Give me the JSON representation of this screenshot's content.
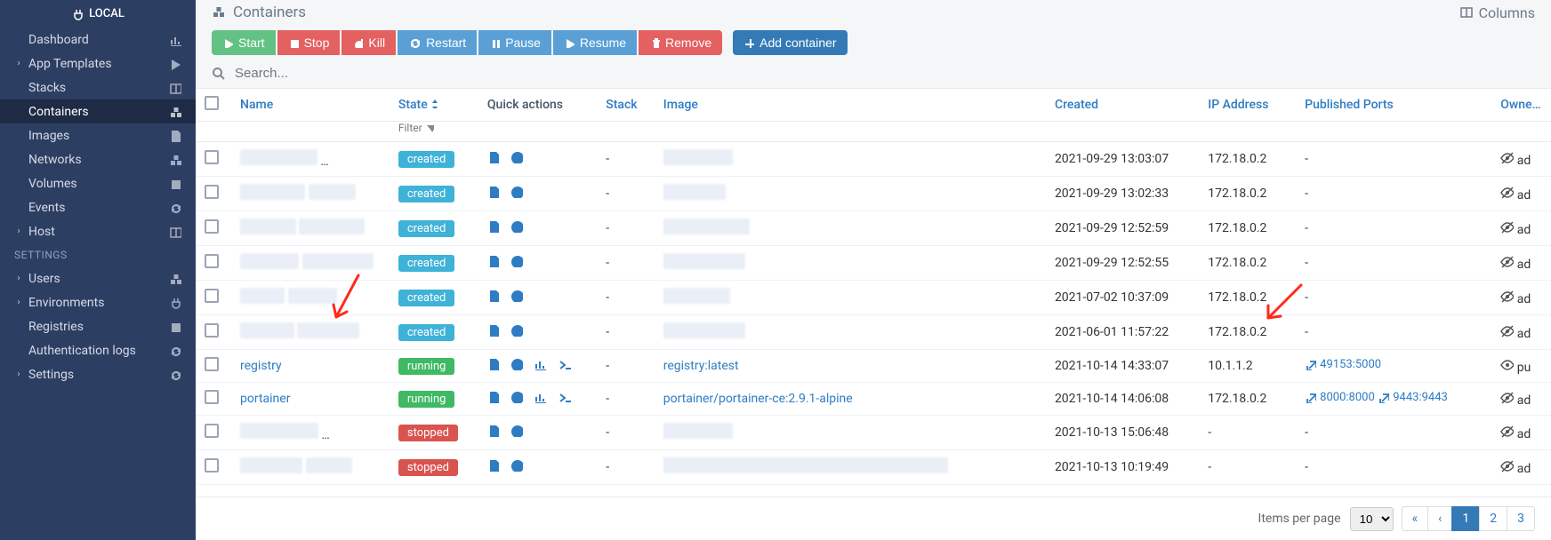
{
  "sidebar": {
    "header": "LOCAL",
    "items": [
      {
        "label": "Dashboard",
        "chev": false,
        "icon": "tachometer"
      },
      {
        "label": "App Templates",
        "chev": true,
        "icon": "rocket"
      },
      {
        "label": "Stacks",
        "chev": false,
        "icon": "list"
      },
      {
        "label": "Containers",
        "chev": false,
        "icon": "cubes",
        "active": true
      },
      {
        "label": "Images",
        "chev": false,
        "icon": "copy"
      },
      {
        "label": "Networks",
        "chev": false,
        "icon": "sitemap"
      },
      {
        "label": "Volumes",
        "chev": false,
        "icon": "hdd"
      },
      {
        "label": "Events",
        "chev": false,
        "icon": "history"
      },
      {
        "label": "Host",
        "chev": true,
        "icon": "th"
      }
    ],
    "section": "SETTINGS",
    "settings": [
      {
        "label": "Users",
        "chev": true,
        "icon": "users"
      },
      {
        "label": "Environments",
        "chev": true,
        "icon": "plug"
      },
      {
        "label": "Registries",
        "chev": false,
        "icon": "database"
      },
      {
        "label": "Authentication logs",
        "chev": false,
        "icon": "history"
      },
      {
        "label": "Settings",
        "chev": true,
        "icon": "cogs"
      }
    ]
  },
  "page": {
    "title": "Containers",
    "columns_btn": "Columns"
  },
  "toolbar": {
    "start": "Start",
    "stop": "Stop",
    "kill": "Kill",
    "restart": "Restart",
    "pause": "Pause",
    "resume": "Resume",
    "remove": "Remove",
    "add": "Add container"
  },
  "search": {
    "placeholder": "Search..."
  },
  "columns": {
    "name": "Name",
    "state": "State",
    "filter": "Filter",
    "quick": "Quick actions",
    "stack": "Stack",
    "image": "Image",
    "created": "Created",
    "ip": "IP Address",
    "ports": "Published Ports",
    "ownership": "Ownership"
  },
  "rows": [
    {
      "name": "",
      "state": "created",
      "stack": "-",
      "image": "",
      "created": "2021-09-29 13:03:07",
      "ip": "172.18.0.2",
      "ports": "-",
      "own": "ad",
      "own_icon": "eye-slash",
      "q": 2,
      "blurred": true
    },
    {
      "name": "",
      "state": "created",
      "stack": "-",
      "image": "",
      "created": "2021-09-29 13:02:33",
      "ip": "172.18.0.2",
      "ports": "-",
      "own": "ad",
      "own_icon": "eye-slash",
      "q": 2,
      "blurred": true
    },
    {
      "name": "",
      "state": "created",
      "stack": "-",
      "image": "",
      "created": "2021-09-29 12:52:59",
      "ip": "172.18.0.2",
      "ports": "-",
      "own": "ad",
      "own_icon": "eye-slash",
      "q": 2,
      "blurred": true
    },
    {
      "name": "",
      "state": "created",
      "stack": "-",
      "image": "",
      "created": "2021-09-29 12:52:55",
      "ip": "172.18.0.2",
      "ports": "-",
      "own": "ad",
      "own_icon": "eye-slash",
      "q": 2,
      "blurred": true
    },
    {
      "name": "",
      "state": "created",
      "stack": "-",
      "image": "",
      "created": "2021-07-02 10:37:09",
      "ip": "172.18.0.2",
      "ports": "-",
      "own": "ad",
      "own_icon": "eye-slash",
      "q": 2,
      "blurred": true
    },
    {
      "name": "",
      "state": "created",
      "stack": "-",
      "image": "",
      "created": "2021-06-01 11:57:22",
      "ip": "172.18.0.2",
      "ports": "-",
      "own": "ad",
      "own_icon": "eye-slash",
      "q": 2,
      "blurred": true
    },
    {
      "name": "registry",
      "state": "running",
      "stack": "-",
      "image": "registry:latest",
      "created": "2021-10-14 14:33:07",
      "ip": "10.1.1.2",
      "ports": "49153:5000",
      "own": "pu",
      "own_icon": "eye",
      "q": 4,
      "blurred": false
    },
    {
      "name": "portainer",
      "state": "running",
      "stack": "-",
      "image": "portainer/portainer-ce:2.9.1-alpine",
      "created": "2021-10-14 14:06:08",
      "ip": "172.18.0.2",
      "ports": "8000:8000",
      "ports2": "9443:9443",
      "own": "ad",
      "own_icon": "eye-slash",
      "q": 4,
      "blurred": false
    },
    {
      "name": "",
      "state": "stopped",
      "stack": "-",
      "image": "",
      "created": "2021-10-13 15:06:48",
      "ip": "-",
      "ports": "-",
      "own": "ad",
      "own_icon": "eye-slash",
      "q": 2,
      "blurred": true
    },
    {
      "name": "",
      "state": "stopped",
      "stack": "-",
      "image": "",
      "created": "2021-10-13 10:19:49",
      "ip": "-",
      "ports": "-",
      "own": "ad",
      "own_icon": "eye-slash",
      "q": 2,
      "blurred": true,
      "imgwide": true
    }
  ],
  "pager": {
    "label": "Items per page",
    "size": "10",
    "pages": [
      "1",
      "2",
      "3"
    ],
    "active": "1"
  }
}
